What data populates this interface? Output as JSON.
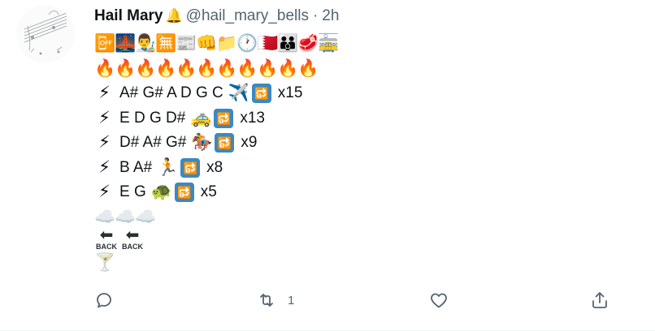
{
  "user": {
    "name": "Hail Mary",
    "bell_icon": "🔔",
    "handle": "@hail_mary_bells",
    "dot": "·",
    "time": "2h"
  },
  "emoji_row1": [
    "📴",
    "🌉",
    "👨‍🎨",
    "🈚",
    "📰",
    "👊",
    "📁",
    "🕐",
    "🇧🇭",
    "👪",
    "🥩",
    "🚋"
  ],
  "fire_row": [
    "🔥",
    "🔥",
    "🔥",
    "🔥",
    "🔥",
    "🔥",
    "🔥",
    "🔥",
    "🔥",
    "🔥",
    "🔥"
  ],
  "sequences": [
    {
      "bolt": "⚡",
      "notes": "A# G# A D G C",
      "emoji": "✈️",
      "repeat_icon": "🔂",
      "count": "x15"
    },
    {
      "bolt": "⚡",
      "notes": "E D G D#",
      "emoji": "🚕",
      "repeat_icon": "🔂",
      "count": "x13"
    },
    {
      "bolt": "⚡",
      "notes": "D# A# G#",
      "emoji": "🏇",
      "repeat_icon": "🔂",
      "count": "x9"
    },
    {
      "bolt": "⚡",
      "notes": "B A#",
      "emoji": "🏃",
      "repeat_icon": "🔂",
      "count": "x8"
    },
    {
      "bolt": "⚡",
      "notes": "E G",
      "emoji": "🐢",
      "repeat_icon": "🔂",
      "count": "x5"
    }
  ],
  "cloud_row": [
    "☁️",
    "☁️",
    "☁️"
  ],
  "back_row": [
    {
      "arrow": "⬅",
      "label": "BACK"
    },
    {
      "arrow": "⬅",
      "label": "BACK"
    }
  ],
  "drink": "🍸",
  "actions": {
    "reply_count": "",
    "retweet_count": "1",
    "like_count": "",
    "share_count": ""
  }
}
